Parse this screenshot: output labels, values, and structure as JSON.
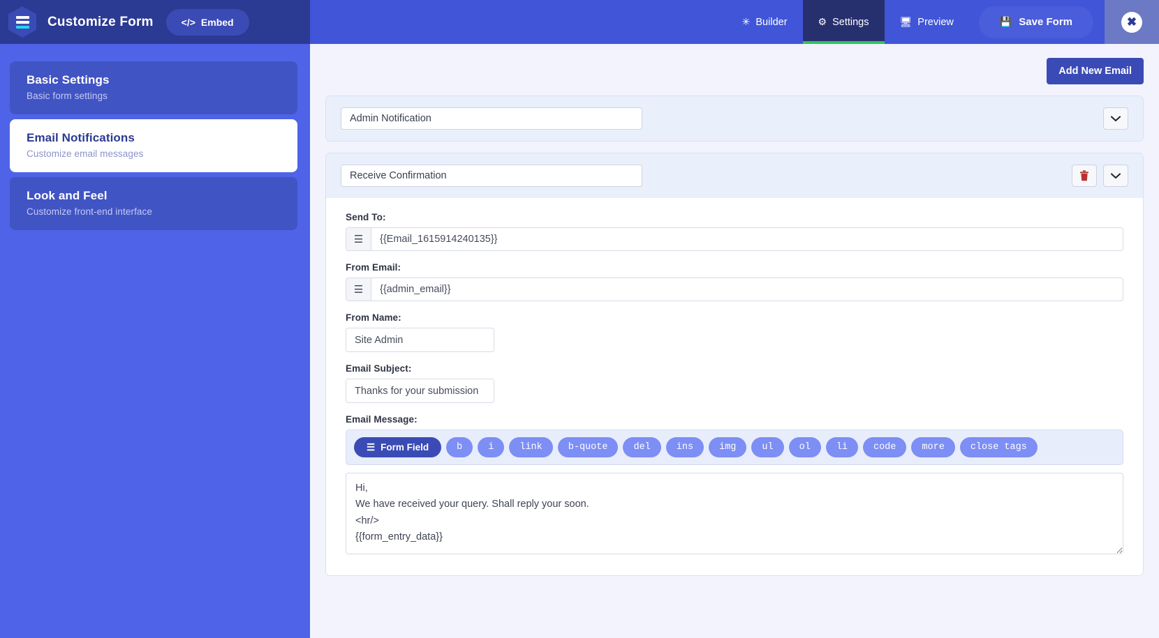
{
  "topbar": {
    "logo_icon": "hamburger-hexagon-logo",
    "title": "Customize Form",
    "embed_label": "Embed",
    "embed_icon": "code-icon",
    "nav": [
      {
        "label": "Builder",
        "icon": "tools-icon",
        "active": false
      },
      {
        "label": "Settings",
        "icon": "gears-icon",
        "active": true
      },
      {
        "label": "Preview",
        "icon": "monitor-icon",
        "active": false
      }
    ],
    "save_label": "Save Form",
    "save_icon": "save-icon",
    "close_icon": "close-x-icon"
  },
  "sidebar": {
    "items": [
      {
        "title": "Basic Settings",
        "subtitle": "Basic form settings",
        "active": false
      },
      {
        "title": "Email Notifications",
        "subtitle": "Customize email messages",
        "active": true
      },
      {
        "title": "Look and Feel",
        "subtitle": "Customize front-end interface",
        "active": false
      }
    ]
  },
  "main": {
    "add_new_email_label": "Add New Email",
    "panels": [
      {
        "name": "Admin Notification",
        "expanded": false,
        "has_delete": false,
        "chevron_icon": "chevron-down-icon"
      },
      {
        "name": "Receive Confirmation",
        "expanded": true,
        "has_delete": true,
        "delete_icon": "trash-icon",
        "chevron_icon": "chevron-down-icon",
        "fields": {
          "send_to_label": "Send To:",
          "send_to_value": "{{Email_1615914240135}}",
          "from_email_label": "From Email:",
          "from_email_value": "{{admin_email}}",
          "from_name_label": "From Name:",
          "from_name_value": "Site Admin",
          "email_subject_label": "Email Subject:",
          "email_subject_value": "Thanks for your submission",
          "email_message_label": "Email Message:",
          "prefix_icon": "hamburger-icon",
          "toolbar": [
            {
              "label": "Form Field",
              "primary": true,
              "icon": "hamburger-icon"
            },
            {
              "label": "b",
              "primary": false
            },
            {
              "label": "i",
              "primary": false
            },
            {
              "label": "link",
              "primary": false
            },
            {
              "label": "b-quote",
              "primary": false
            },
            {
              "label": "del",
              "primary": false
            },
            {
              "label": "ins",
              "primary": false
            },
            {
              "label": "img",
              "primary": false
            },
            {
              "label": "ul",
              "primary": false
            },
            {
              "label": "ol",
              "primary": false
            },
            {
              "label": "li",
              "primary": false
            },
            {
              "label": "code",
              "primary": false
            },
            {
              "label": "more",
              "primary": false
            },
            {
              "label": "close tags",
              "primary": false
            }
          ],
          "email_message_value": "Hi,\nWe have received your query. Shall reply your soon.\n<hr/>\n{{form_entry_data}}"
        }
      }
    ]
  },
  "colors": {
    "brand_blue": "#4055d8",
    "dark_blue": "#2b3a92",
    "sidebar_blue": "#4f63e8",
    "active_tab": "#27306f",
    "accent_green": "#2fc55c",
    "page_bg": "#f2f3fd",
    "tool_blue": "#7d8ef5",
    "danger_red": "#b93232"
  }
}
